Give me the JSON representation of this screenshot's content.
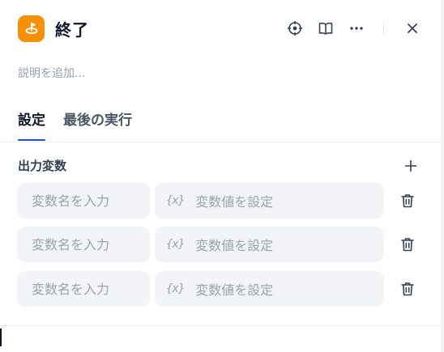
{
  "header": {
    "title": "終了",
    "icons": [
      "end-node-icon",
      "target-icon",
      "book-open-icon",
      "more-icon",
      "close-icon"
    ],
    "accent_color": "#f79009"
  },
  "description": {
    "placeholder": "説明を追加..."
  },
  "tabs": [
    {
      "label": "設定",
      "active": true
    },
    {
      "label": "最後の実行",
      "active": false
    }
  ],
  "output_section": {
    "title": "出力変数",
    "rows": [
      {
        "name_placeholder": "変数名を入力",
        "value_glyph": "{x}",
        "value_placeholder": "変数値を設定"
      },
      {
        "name_placeholder": "変数名を入力",
        "value_glyph": "{x}",
        "value_placeholder": "変数値を設定"
      },
      {
        "name_placeholder": "変数名を入力",
        "value_glyph": "{x}",
        "value_placeholder": "変数値を設定"
      }
    ]
  },
  "colors": {
    "tab_underline": "#1d4ed8",
    "field_bg": "#f2f4f7",
    "placeholder": "#98a2b3"
  }
}
